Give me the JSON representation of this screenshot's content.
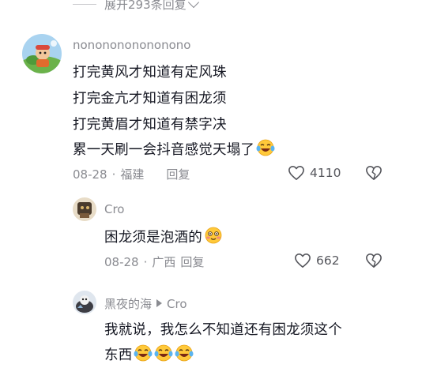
{
  "expand": {
    "label": "展开293条回复"
  },
  "comments": [
    {
      "username": "nononononononono",
      "lines": [
        "打完黄风才知道有定风珠",
        "打完金亢才知道有困龙须",
        "打完黄眉才知道有禁字决",
        "累一天刷一会抖音感觉天塌了"
      ],
      "date": "08-28",
      "location": "福建",
      "reply": "回复",
      "likes": "4110"
    },
    {
      "username": "Cro",
      "lines": [
        "困龙须是泡酒的"
      ],
      "date": "08-28",
      "location": "广西",
      "reply": "回复",
      "likes": "662"
    },
    {
      "username": "黑夜的海",
      "reply_to": "Cro",
      "lines": [
        "我就说，我怎么不知道还有困龙须这个",
        "东西"
      ]
    }
  ],
  "icons": [
    "chevron-down-icon",
    "heart-icon",
    "dislike-heart-icon",
    "laughing-tears-emoji",
    "smiling-blush-emoji",
    "reply-arrow-icon"
  ]
}
